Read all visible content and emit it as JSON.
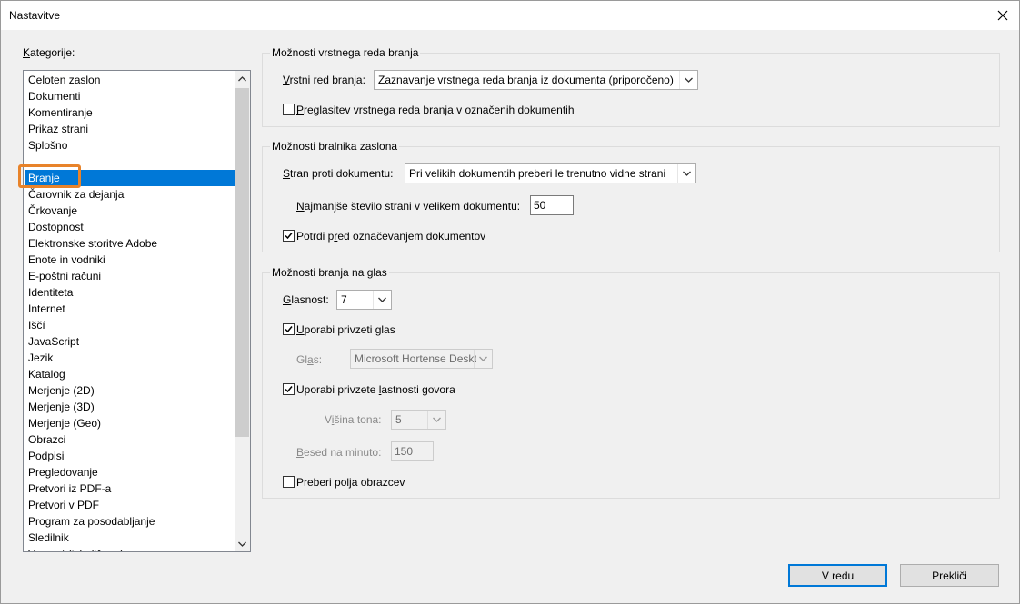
{
  "window": {
    "title": "Nastavitve"
  },
  "categories": {
    "label_underlined": "K",
    "label_rest": "ategorije:",
    "items_top": [
      "Celoten zaslon",
      "Dokumenti",
      "Komentiranje",
      "Prikaz strani",
      "Splošno"
    ],
    "items_main": [
      "Branje",
      "Čarovnik za dejanja",
      "Črkovanje",
      "Dostopnost",
      "Elektronske storitve Adobe",
      "Enote in vodniki",
      "E-poštni računi",
      "Identiteta",
      "Internet",
      "Iščí",
      "JavaScript",
      "Jezik",
      "Katalog",
      "Merjenje (2D)",
      "Merjenje (3D)",
      "Merjenje (Geo)",
      "Obrazci",
      "Podpisi",
      "Pregledovanje",
      "Pretvori iz PDF-a",
      "Pretvori v PDF",
      "Program za posodabljanje",
      "Sledilnik",
      "Varnost (izboljšano)"
    ],
    "selected": "Branje"
  },
  "reading_order": {
    "legend": "Možnosti vrstnega reda branja",
    "label_underlined": "V",
    "label_rest": "rstni red branja:",
    "value": "Zaznavanje vrstnega reda branja iz dokumenta (priporočeno)",
    "override_label_underlined": "P",
    "override_label_rest": "reglasitev vrstnega reda branja v označenih dokumentih",
    "override_checked": false
  },
  "screen_reader": {
    "legend": "Možnosti bralnika zaslona",
    "pages_label_underlined": "S",
    "pages_label_rest": "tran proti dokumentu:",
    "pages_value": "Pri velikih dokumentih preberi le trenutno vidne strani",
    "min_pages_label_underlined": "N",
    "min_pages_label_rest": "ajmanjše število strani v velikem dokumentu:",
    "min_pages_value": "50",
    "confirm_label_pre": "Potrdi p",
    "confirm_label_underlined": "r",
    "confirm_label_post": "ed označevanjem dokumentov",
    "confirm_checked": true
  },
  "read_aloud": {
    "legend": "Možnosti branja na glas",
    "volume_label_underlined": "G",
    "volume_label_rest": "lasnost:",
    "volume_value": "7",
    "default_voice_label_underlined": "U",
    "default_voice_label_rest": "porabi privzeti glas",
    "default_voice_checked": true,
    "voice_label_pre": "Gl",
    "voice_label_underlined": "a",
    "voice_label_post": "s:",
    "voice_value": "Microsoft Hortense Deskt",
    "default_speech_label_pre": "Uporabi privzete ",
    "default_speech_label_underlined": "l",
    "default_speech_label_post": "astnosti govora",
    "default_speech_checked": true,
    "pitch_label_pre": "V",
    "pitch_label_underlined": "i",
    "pitch_label_post": "šina tona:",
    "pitch_value": "5",
    "wpm_label_underlined": "B",
    "wpm_label_rest": "esed na minuto:",
    "wpm_value": "150",
    "form_fields_label": "Preberi polja obrazcev",
    "form_fields_checked": false
  },
  "buttons": {
    "ok": "V redu",
    "cancel": "Prekliči"
  }
}
